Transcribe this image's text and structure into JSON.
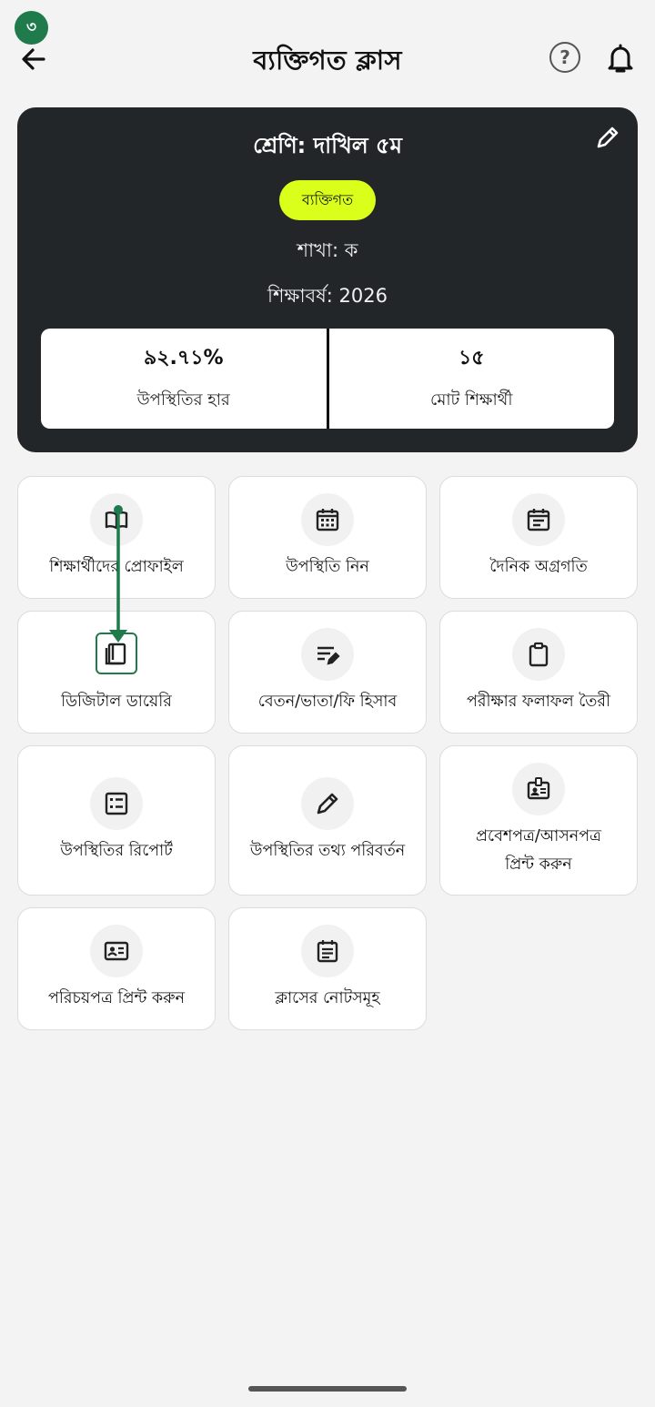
{
  "step_badge": "৩",
  "header": {
    "title": "ব্যক্তিগত ক্লাস"
  },
  "class_card": {
    "class_name": "শ্রেণি: দাখিল ৫ম",
    "type_badge": "ব্যক্তিগত",
    "section": "শাখা: ক",
    "academic_year": "শিক্ষাবর্ষ: 2026",
    "badge_color": "#d9ff1a",
    "stats": [
      {
        "value": "৯২.৭১%",
        "label": "উপস্থিতির হার"
      },
      {
        "value": "১৫",
        "label": "মোট শিক্ষার্থী"
      }
    ]
  },
  "menu": [
    {
      "label": "শিক্ষার্থীদের প্রোফাইল",
      "icon": "open-book-icon"
    },
    {
      "label": "উপস্থিতি নিন",
      "icon": "calendar-grid-icon"
    },
    {
      "label": "দৈনিক অগ্রগতি",
      "icon": "calendar-list-icon"
    },
    {
      "label": "ডিজিটাল ডায়েরি",
      "icon": "diary-book-icon"
    },
    {
      "label": "বেতন/ভাতা/ফি হিসাব",
      "icon": "edit-note-icon"
    },
    {
      "label": "পরীক্ষার ফলাফল তৈরী",
      "icon": "clipboard-icon"
    },
    {
      "label": "উপস্থিতির রিপোর্ট",
      "icon": "list-report-icon"
    },
    {
      "label_line1": "প্রবেশপত্র/আসনপত্র",
      "label_line2": "প্রিন্ট করুন",
      "icon": "id-badge-icon"
    },
    {
      "label": "উপস্থিতির তথ্য পরিবর্তন",
      "icon": "pencil-icon"
    },
    {
      "label": "পরিচয়পত্র প্রিন্ট করুন",
      "icon": "id-card-icon"
    },
    {
      "label": "ক্লাসের নোটসমূহ",
      "icon": "notes-icon"
    }
  ],
  "accent_color": "#1f7a4c"
}
